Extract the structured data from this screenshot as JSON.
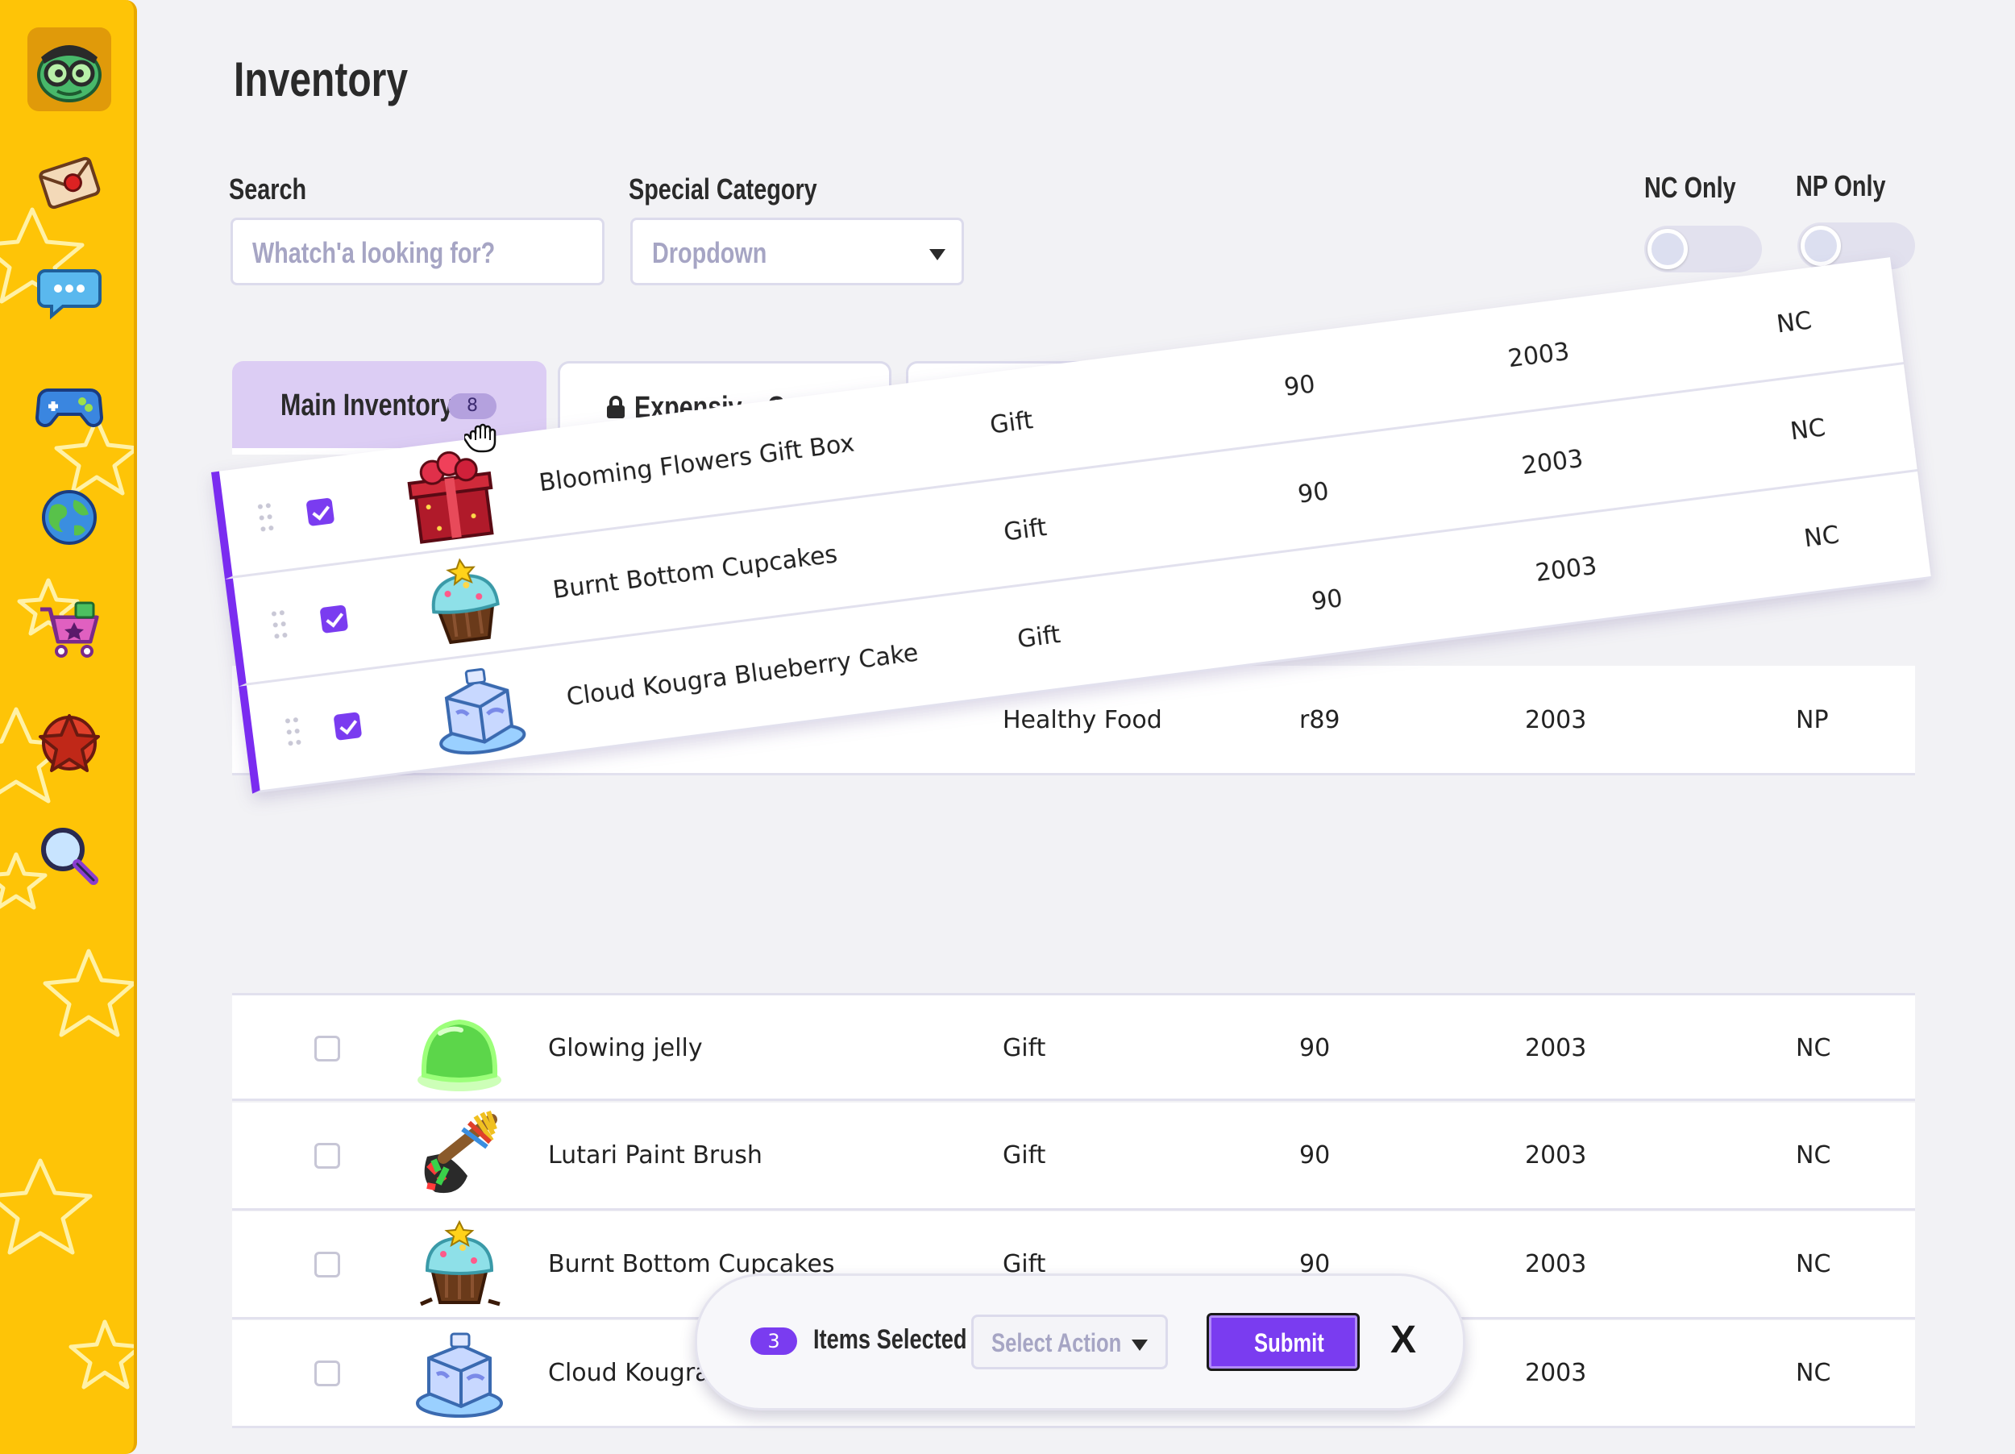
{
  "page": {
    "title": "Inventory"
  },
  "filters": {
    "search_label": "Search",
    "search_placeholder": "Whatch'a looking for?",
    "category_label": "Special Category",
    "category_value": "Dropdown",
    "nc_only_label": "NC Only",
    "np_only_label": "NP Only"
  },
  "tabs": {
    "main": {
      "label": "Main Inventory",
      "count": "8"
    },
    "expensive": {
      "label": "Expensiv... C..."
    }
  },
  "dragged_rows": [
    {
      "name": "Blooming Flowers Gift Box",
      "category": "Gift",
      "rarity": "90",
      "year": "2003",
      "currency": "NC",
      "checked": true
    },
    {
      "name": "Burnt Bottom Cupcakes",
      "category": "Gift",
      "rarity": "90",
      "year": "2003",
      "currency": "NC",
      "checked": true
    },
    {
      "name": "Cloud Kougra Blueberry Cake",
      "category": "Gift",
      "rarity": "90",
      "year": "2003",
      "currency": "NC",
      "checked": true
    }
  ],
  "partial_row": {
    "category": "Healthy Food",
    "rarity": "r89",
    "year": "2003",
    "currency": "NP"
  },
  "rows": [
    {
      "name": "Glowing jelly",
      "category": "Gift",
      "rarity": "90",
      "year": "2003",
      "currency": "NC",
      "checked": false
    },
    {
      "name": "Lutari Paint Brush",
      "category": "Gift",
      "rarity": "90",
      "year": "2003",
      "currency": "NC",
      "checked": false
    },
    {
      "name": "Burnt Bottom Cupcakes",
      "category": "Gift",
      "rarity": "90",
      "year": "2003",
      "currency": "NC",
      "checked": false
    },
    {
      "name": "Cloud Kougra L",
      "category": "",
      "rarity": "",
      "year": "2003",
      "currency": "NC",
      "checked": false
    }
  ],
  "action_bar": {
    "count": "3",
    "label": "Items Selected",
    "select_placeholder": "Select Action",
    "submit_label": "Submit",
    "close_label": "X"
  },
  "icons": {
    "sidebar": [
      "avatar-icon",
      "mail-icon",
      "chat-icon",
      "gamepad-icon",
      "globe-icon",
      "shopping-cart-icon",
      "star-badge-icon",
      "search-icon"
    ]
  },
  "colors": {
    "accent": "#7a3cf0",
    "sidebar": "#fec407",
    "tab_active": "#dccdf4"
  }
}
